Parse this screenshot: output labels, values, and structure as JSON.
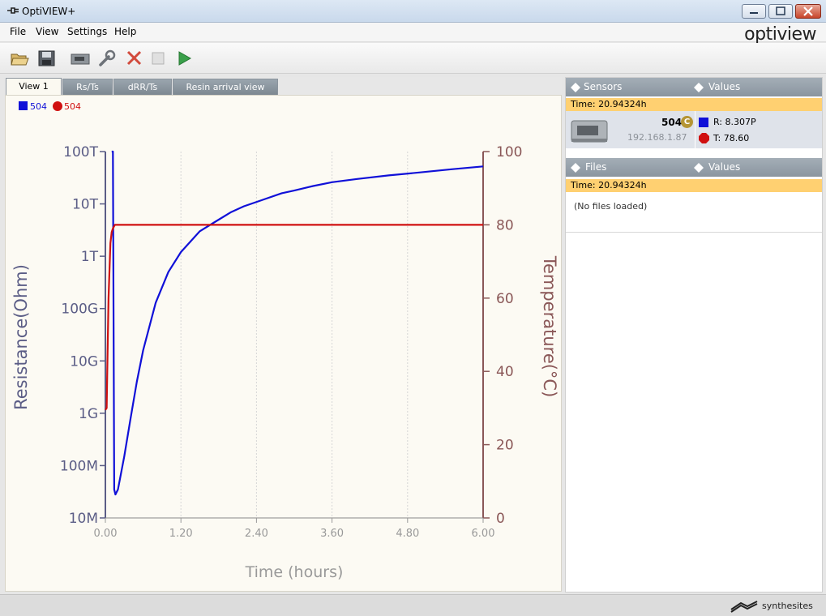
{
  "window": {
    "title": "OptiVIEW+",
    "brand_logo": "optiview"
  },
  "menu": [
    "File",
    "View",
    "Settings",
    "Help"
  ],
  "toolbar": {
    "icons": [
      "open-folder-icon",
      "save-icon",
      "device-icon",
      "wrench-icon",
      "delete-icon",
      "stop-icon",
      "play-icon"
    ]
  },
  "tabs": [
    {
      "label": "View 1",
      "active": true
    },
    {
      "label": "Rs/Ts",
      "active": false
    },
    {
      "label": "dRR/Ts",
      "active": false
    },
    {
      "label": "Resin arrival view",
      "active": false
    }
  ],
  "legend": [
    {
      "label": "504",
      "marker": "square",
      "color": "#1010d8"
    },
    {
      "label": "504",
      "marker": "circle",
      "color": "#d01010"
    }
  ],
  "chart_data": {
    "type": "line",
    "xlabel": "Time (hours)",
    "ylabel": "Resistance(Ohm)",
    "y2label": "Temperature(°C)",
    "xlim": [
      0,
      6
    ],
    "x_ticks": [
      "0.00",
      "1.20",
      "2.40",
      "3.60",
      "4.80",
      "6.00"
    ],
    "y_scale": "log",
    "ylim": [
      10000000.0,
      100000000000000.0
    ],
    "y_ticks": [
      "10M",
      "100M",
      "1G",
      "10G",
      "100G",
      "1T",
      "10T",
      "100T"
    ],
    "y2lim": [
      0,
      100
    ],
    "y2_ticks": [
      "0",
      "20",
      "40",
      "60",
      "80",
      "100"
    ],
    "grid": true,
    "series": [
      {
        "name": "504",
        "axis": "left",
        "color": "#1010d8",
        "x": [
          0.1,
          0.12,
          0.14,
          0.16,
          0.2,
          0.3,
          0.4,
          0.5,
          0.6,
          0.8,
          1.0,
          1.2,
          1.5,
          1.8,
          2.0,
          2.2,
          2.5,
          2.8,
          3.0,
          3.3,
          3.6,
          4.0,
          4.5,
          5.0,
          5.5,
          6.0
        ],
        "y": [
          100000000000000.0,
          100000000000000.0,
          35000000.0,
          28000000.0,
          35000000.0,
          150000000.0,
          800000000.0,
          4000000000.0,
          16000000000.0,
          130000000000.0,
          500000000000.0,
          1200000000000.0,
          3000000000000.0,
          5000000000000.0,
          7000000000000.0,
          9000000000000.0,
          12000000000000.0,
          16000000000000.0,
          18000000000000.0,
          22000000000000.0,
          26000000000000.0,
          30000000000000.0,
          35000000000000.0,
          40000000000000.0,
          46000000000000.0,
          52000000000000.0
        ]
      },
      {
        "name": "504",
        "axis": "right",
        "color": "#d01010",
        "x": [
          0.0,
          0.02,
          0.03,
          0.05,
          0.08,
          0.1,
          0.12,
          0.15,
          0.2,
          0.3,
          0.5,
          1.0,
          2.0,
          3.0,
          4.0,
          5.0,
          6.0
        ],
        "y": [
          29.5,
          30,
          40,
          60,
          75,
          78,
          79,
          80,
          80,
          80,
          80,
          80,
          80,
          80,
          80,
          80,
          80
        ]
      }
    ]
  },
  "sensors_panel": {
    "header_left": "Sensors",
    "header_right": "Values",
    "time": "Time: 20.94324h",
    "sensor": {
      "id": "504",
      "badge": "C",
      "ip": "192.168.1.87",
      "resistance": "R: 8.307P",
      "temperature": "T: 78.60",
      "r_color": "#1010d8",
      "t_color": "#d01010"
    }
  },
  "files_panel": {
    "header_left": "Files",
    "header_right": "Values",
    "time": "Time: 20.94324h",
    "empty_message": "(No files loaded)"
  },
  "footer": {
    "brand": "synthesites"
  }
}
